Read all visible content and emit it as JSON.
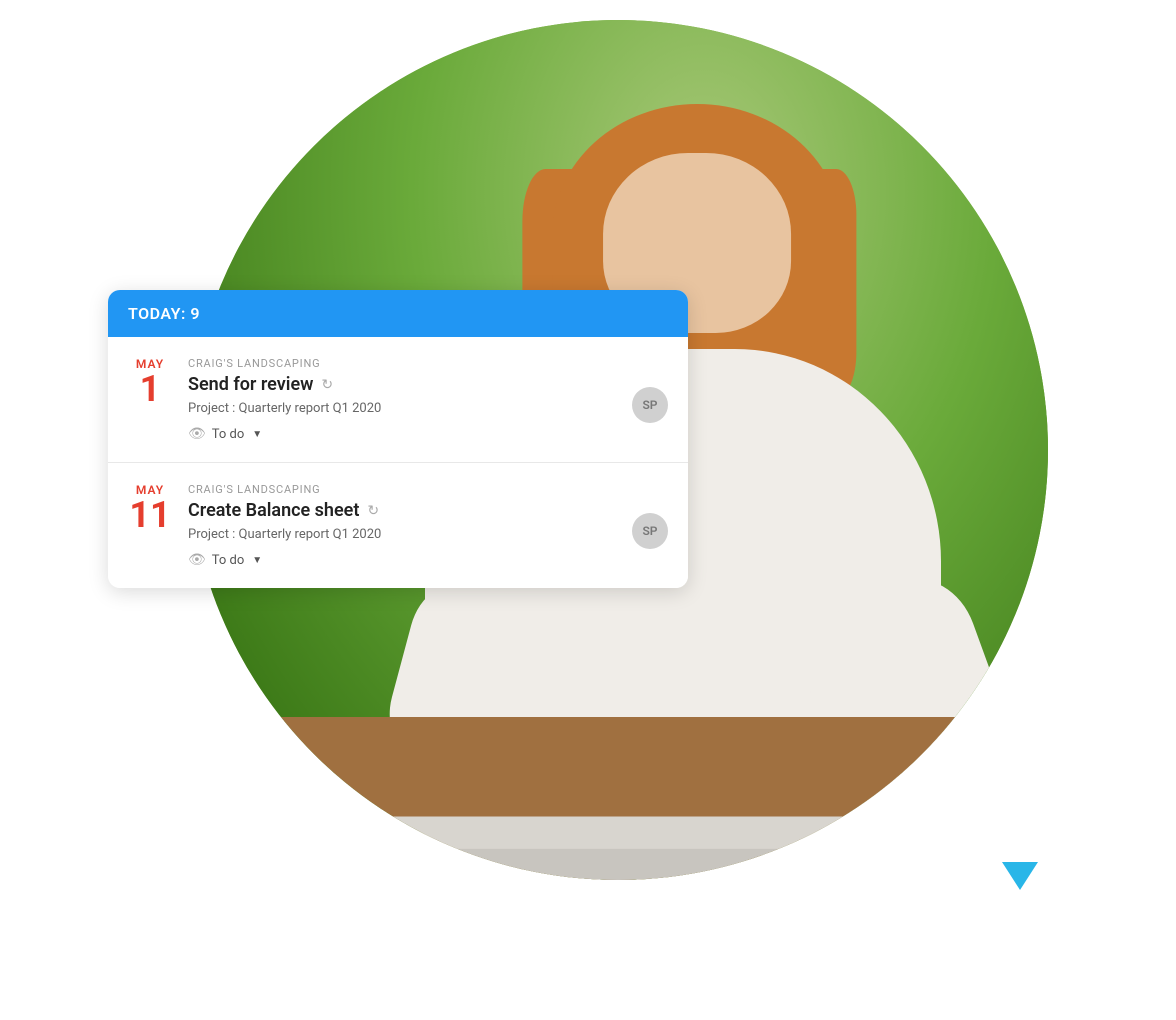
{
  "panel": {
    "header": {
      "label": "TODAY:",
      "count": "9"
    },
    "tasks": [
      {
        "date_month": "MAY",
        "date_day": "1",
        "client": "CRAIG'S LANDSCAPING",
        "title": "Send for review",
        "project": "Project : Quarterly report Q1 2020",
        "status": "To do",
        "avatar_initials": "SP"
      },
      {
        "date_month": "MAY",
        "date_day": "11",
        "client": "CRAIG'S LANDSCAPING",
        "title": "Create Balance sheet",
        "project": "Project : Quarterly report Q1 2020",
        "status": "To do",
        "avatar_initials": "SP"
      }
    ]
  },
  "icons": {
    "refresh": "↻",
    "eye": "👁",
    "dropdown_arrow": "▼"
  },
  "colors": {
    "accent_blue": "#2196F3",
    "date_red": "#e53e2e",
    "avatar_bg": "#d0d0d0"
  }
}
